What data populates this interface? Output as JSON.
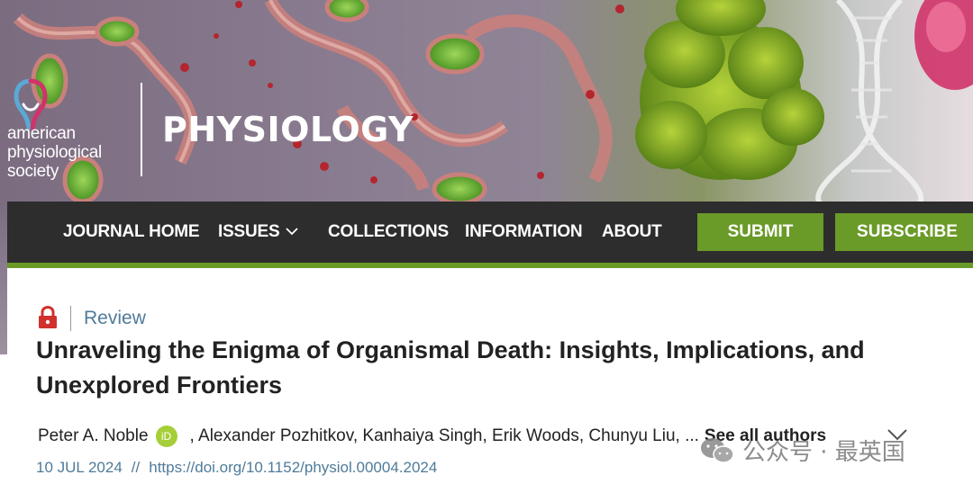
{
  "brand": {
    "society_lines": [
      "american",
      "physiological",
      "society"
    ],
    "journal_name": "PHYSIOLOGY"
  },
  "nav": {
    "items": [
      {
        "label": "JOURNAL HOME"
      },
      {
        "label": "ISSUES"
      },
      {
        "label": "COLLECTIONS"
      },
      {
        "label": "INFORMATION"
      },
      {
        "label": "ABOUT"
      }
    ],
    "submit_label": "SUBMIT",
    "subscribe_label": "SUBSCRIBE",
    "colors": {
      "bar": "#2d2d2d",
      "accent": "#6a9a27"
    }
  },
  "article": {
    "type": "Review",
    "title": "Unraveling the Enigma of Organismal Death: Insights, Implications, and Unexplored Frontiers",
    "first_author": "Peter A. Noble",
    "orcid_label": "iD",
    "other_authors": ", Alexander Pozhitkov, Kanhaiya Singh, Erik Woods, Chunyu Liu, ...",
    "see_all_label": "See all authors",
    "date": "10 JUL 2024",
    "date_separator": "//",
    "doi": "https://doi.org/10.1152/physiol.00004.2024",
    "lock_color": "#d0312d"
  },
  "watermark": {
    "text": "公众号 · 最英国"
  }
}
